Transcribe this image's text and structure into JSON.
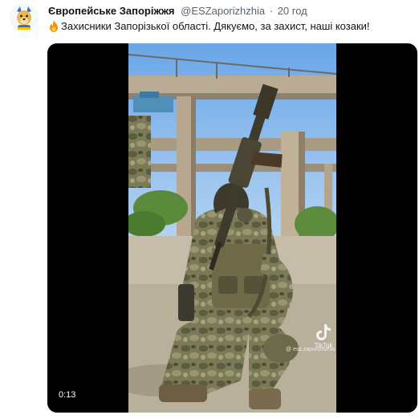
{
  "tweet": {
    "author_name": "Європейське Запоріжжя",
    "handle": "@ESZaporizhzhia",
    "separator": "·",
    "time": "20 год",
    "text": "Захисники Запорізької області. Дякуємо, за захист, наші козаки!",
    "icon": "fire-emoji-icon"
  },
  "video": {
    "duration": "0:13",
    "watermark": "TikTok",
    "watermark_handle": "@ esz.zaporizhzhia"
  },
  "colors": {
    "accent": "#1d9bf0",
    "sky": "#7fb0e6",
    "camo": "#6b6a4a",
    "ground": "#bfb8a6"
  }
}
